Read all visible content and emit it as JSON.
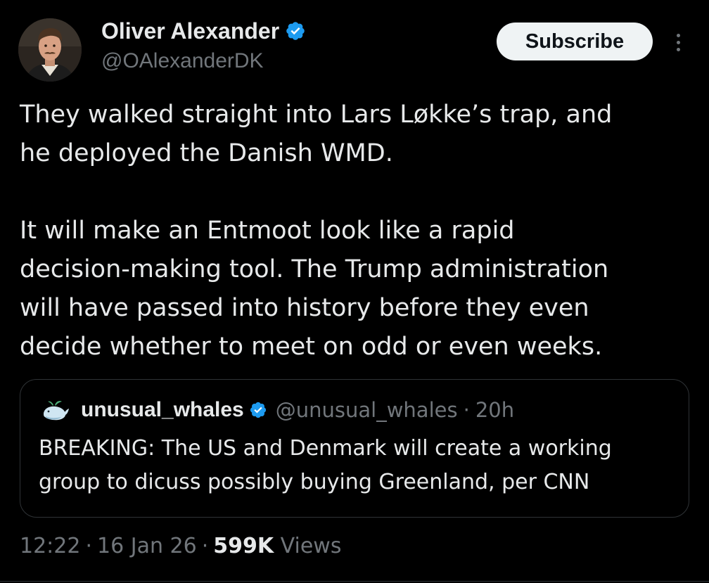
{
  "author": {
    "name": "Oliver Alexander",
    "handle": "@OAlexanderDK",
    "verified": true,
    "avatar_icon": "profile-photo"
  },
  "actions": {
    "subscribe_label": "Subscribe",
    "more_icon": "more-vertical-icon"
  },
  "tweet": {
    "paragraphs": [
      "They walked straight into Lars Løkke’s trap, and\nhe deployed the Danish WMD.",
      "It will make an Entmoot look like a rapid\ndecision-making tool. The Trump administration\nwill have passed into history before they even\ndecide whether to meet on odd or even weeks."
    ]
  },
  "quote": {
    "name": "unusual_whales",
    "handle": "@unusual_whales",
    "separator": "·",
    "time": "20h",
    "verified": true,
    "avatar_icon": "whale-icon",
    "text": "BREAKING: The US and Denmark will create a working\ngroup to dicuss possibly buying Greenland, per CNN"
  },
  "meta": {
    "time": "12:22",
    "separator": "·",
    "date": "16 Jan 26",
    "views_count": "599K",
    "views_label": "Views"
  },
  "colors": {
    "background": "#000000",
    "text_primary": "#e7e9ea",
    "text_secondary": "#71767b",
    "verified_blue": "#1d9bf0",
    "border": "#2f3336",
    "button_bg": "#eff3f4"
  }
}
